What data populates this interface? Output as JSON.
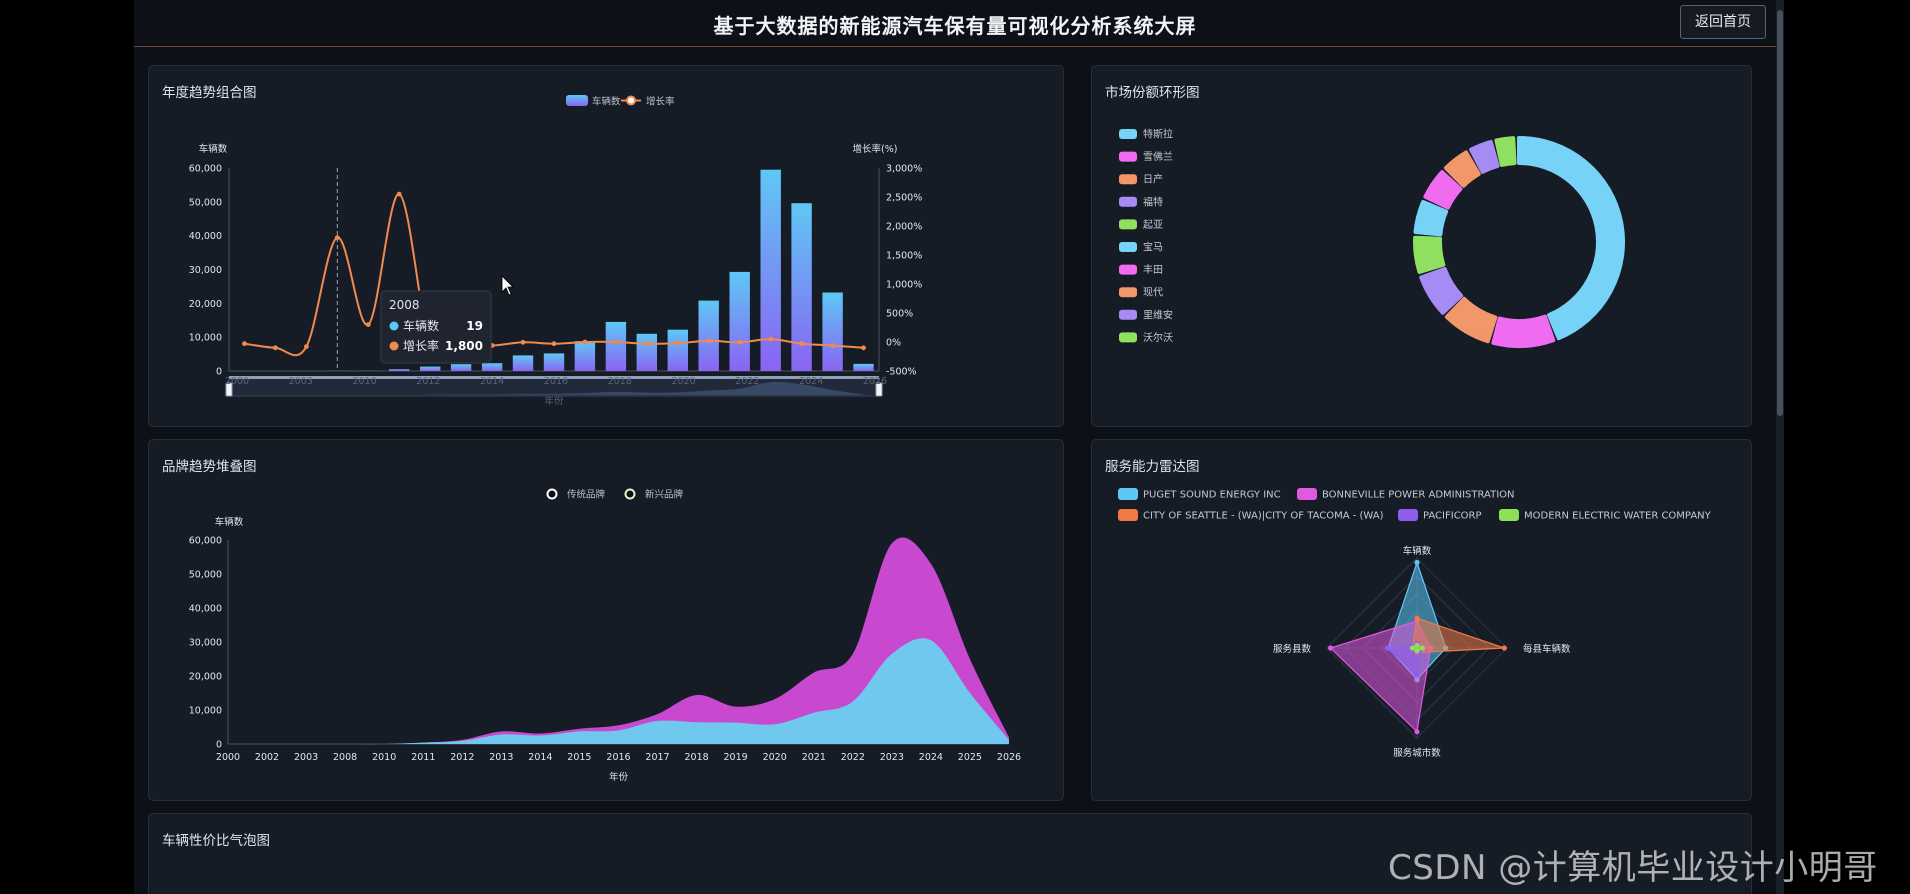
{
  "header": {
    "title": "基于大数据的新能源汽车保有量可视化分析系统大屏",
    "back_label": "返回首页"
  },
  "colors": {
    "bar_top": "#5ec8f5",
    "bar_bottom": "#8a64f3",
    "line": "#f08a4e",
    "traditional": "#6cd0f0",
    "emerging": "#d24bd8"
  },
  "panels": {
    "combo": {
      "title": "年度趋势组合图"
    },
    "ring": {
      "title": "市场份额环形图"
    },
    "stack": {
      "title": "品牌趋势堆叠图"
    },
    "radar": {
      "title": "服务能力雷达图"
    },
    "bubble": {
      "title": "车辆性价比气泡图"
    }
  },
  "chart_data": [
    {
      "type": "bar",
      "title": "年度趋势组合图",
      "legend": [
        "车辆数",
        "增长率"
      ],
      "ylabel": "车辆数",
      "y2label": "增长率(%)",
      "ylim": [
        0,
        60000
      ],
      "y2lim": [
        -500,
        3000
      ],
      "yticks": [
        "60,000",
        "50,000",
        "40,000",
        "30,000",
        "20,000",
        "10,000",
        "0"
      ],
      "y2ticks": [
        "3,000%",
        "2,500%",
        "2,000%",
        "1,500%",
        "1,000%",
        "500%",
        "0%",
        "-500%"
      ],
      "xtick_labels": [
        "2000",
        "2003",
        "2010",
        "2012",
        "2014",
        "2016",
        "2018",
        "2020",
        "2022",
        "2024",
        "2026"
      ],
      "xlabel": "年份",
      "categories": [
        "2000",
        "2002",
        "2003",
        "2008",
        "2010",
        "2011",
        "2012",
        "2013",
        "2014",
        "2015",
        "2016",
        "2017",
        "2018",
        "2019",
        "2020",
        "2021",
        "2022",
        "2023",
        "2024",
        "2025",
        "2026"
      ],
      "series": [
        {
          "name": "车辆数",
          "type": "bar",
          "values": [
            0,
            0,
            0,
            19,
            38,
            500,
            1300,
            2000,
            2300,
            4600,
            5200,
            8800,
            14500,
            11000,
            12200,
            20800,
            29300,
            59500,
            49600,
            23200,
            2100
          ]
        },
        {
          "name": "增长率",
          "type": "line",
          "values": [
            -30,
            -100,
            -80,
            1800,
            300,
            2550,
            -50,
            -20,
            -60,
            -5,
            -30,
            0,
            0,
            -30,
            -20,
            20,
            -5,
            50,
            -30,
            -60,
            -100
          ]
        }
      ],
      "tooltip": {
        "title": "2008",
        "rows": [
          {
            "label": "车辆数",
            "value": "19"
          },
          {
            "label": "增长率",
            "value": "1,800"
          }
        ]
      }
    },
    {
      "type": "pie",
      "title": "市场份额环形图",
      "categories": [
        "特斯拉",
        "雪佛兰",
        "日产",
        "福特",
        "起亚",
        "宝马",
        "丰田",
        "现代",
        "里维安",
        "沃尔沃"
      ],
      "values": [
        40.5,
        8.6,
        6.8,
        5.9,
        4.9,
        4.4,
        4.2,
        3.6,
        3.0,
        2.4
      ],
      "colors": [
        "#76d3f7",
        "#ef6cf0",
        "#f2976a",
        "#a78bf4",
        "#8fe060",
        "#76d3f7",
        "#ef6cf0",
        "#f2976a",
        "#a78bf4",
        "#8fe060"
      ]
    },
    {
      "type": "area",
      "title": "品牌趋势堆叠图",
      "legend": [
        "传统品牌",
        "新兴品牌"
      ],
      "ylabel": "车辆数",
      "xlabel": "年份",
      "ylim": [
        0,
        60000
      ],
      "yticks": [
        "60,000",
        "50,000",
        "40,000",
        "30,000",
        "20,000",
        "10,000",
        "0"
      ],
      "categories": [
        "2000",
        "2002",
        "2003",
        "2008",
        "2010",
        "2011",
        "2012",
        "2013",
        "2014",
        "2015",
        "2016",
        "2017",
        "2018",
        "2019",
        "2020",
        "2021",
        "2022",
        "2023",
        "2024",
        "2025",
        "2026"
      ],
      "series": [
        {
          "name": "传统品牌",
          "values": [
            0,
            0,
            0,
            0,
            0,
            400,
            900,
            2800,
            2500,
            3700,
            4000,
            6800,
            6400,
            6300,
            5800,
            9200,
            12500,
            26500,
            30500,
            15000,
            1200
          ]
        },
        {
          "name": "新兴品牌",
          "values": [
            0,
            0,
            0,
            0,
            0,
            0,
            300,
            900,
            600,
            800,
            1500,
            2000,
            8000,
            4700,
            7400,
            11800,
            14000,
            32500,
            22500,
            10000,
            800
          ]
        }
      ]
    },
    {
      "type": "radar",
      "title": "服务能力雷达图",
      "legend": [
        "PUGET SOUND ENERGY INC",
        "BONNEVILLE POWER ADMINISTRATION",
        "CITY OF SEATTLE - (WA)|CITY OF TACOMA - (WA)",
        "PACIFICORP",
        "MODERN ELECTRIC WATER COMPANY"
      ],
      "indicators": [
        "车辆数",
        "每县车辆数",
        "服务城市数",
        "服务县数"
      ],
      "series": [
        {
          "name": "PUGET SOUND ENERGY INC",
          "values": [
            0.95,
            0.32,
            0.35,
            0.32
          ],
          "color": "#5ec8f5"
        },
        {
          "name": "BONNEVILLE POWER ADMINISTRATION",
          "values": [
            0.3,
            0.15,
            0.93,
            0.96
          ],
          "color": "#e05ae0"
        },
        {
          "name": "CITY OF SEATTLE - (WA)|CITY OF TACOMA - (WA)",
          "values": [
            0.33,
            0.97,
            0.05,
            0.05
          ],
          "color": "#f07a46"
        },
        {
          "name": "PACIFICORP",
          "values": [
            0.05,
            0.05,
            0.3,
            0.33
          ],
          "color": "#8f5df0"
        },
        {
          "name": "MODERN ELECTRIC WATER COMPANY",
          "values": [
            0.03,
            0.06,
            0.03,
            0.05
          ],
          "color": "#8ee05a"
        }
      ]
    }
  ],
  "watermark": "CSDN @计算机毕业设计小明哥"
}
